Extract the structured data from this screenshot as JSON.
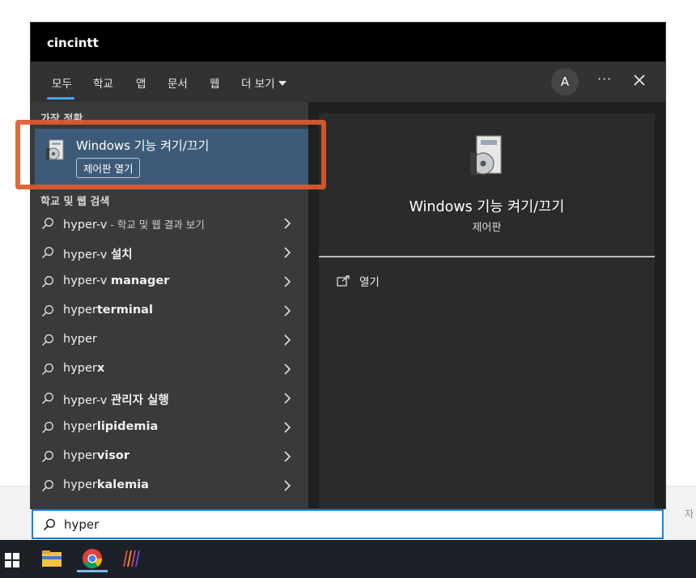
{
  "window": {
    "title": "cincintt"
  },
  "nav": {
    "tabs": [
      {
        "label": "모두",
        "active": true
      },
      {
        "label": "학교"
      },
      {
        "label": "앱"
      },
      {
        "label": "문서"
      },
      {
        "label": "웹"
      }
    ],
    "more_label": "더 보기",
    "avatar_letter": "A",
    "dots_label": "···"
  },
  "best_match": {
    "header": "가장 정확",
    "title": "Windows 기능 켜기/끄기",
    "subtitle": "제어판 열기",
    "icon": "control-panel-features-icon"
  },
  "suggestions": {
    "header": "학교 및 웹 검색",
    "items": [
      {
        "pre": "hyper-v",
        "bold": "",
        "muted": " - 학교 및 웹 결과 보기"
      },
      {
        "pre": "hyper-v ",
        "bold": "설치",
        "muted": ""
      },
      {
        "pre": "hyper-v ",
        "bold": "manager",
        "muted": ""
      },
      {
        "pre": "hyper",
        "bold": "terminal",
        "muted": ""
      },
      {
        "pre": "hyper",
        "bold": "",
        "muted": ""
      },
      {
        "pre": "hyper",
        "bold": "x",
        "muted": ""
      },
      {
        "pre": "hyper-v ",
        "bold": "관리자 실행",
        "muted": ""
      },
      {
        "pre": "hyper",
        "bold": "lipidemia",
        "muted": ""
      },
      {
        "pre": "hyper",
        "bold": "visor",
        "muted": ""
      },
      {
        "pre": "hyper",
        "bold": "kalemia",
        "muted": ""
      }
    ]
  },
  "detail": {
    "title": "Windows 기능 켜기/끄기",
    "subtitle": "제어판",
    "action_label": "열기"
  },
  "search": {
    "value": "hyper"
  },
  "background": {
    "side_text": "자"
  },
  "colors": {
    "accent": "#1a7fd6",
    "selection": "#3d5b78",
    "annotation": "#e05a2f"
  }
}
